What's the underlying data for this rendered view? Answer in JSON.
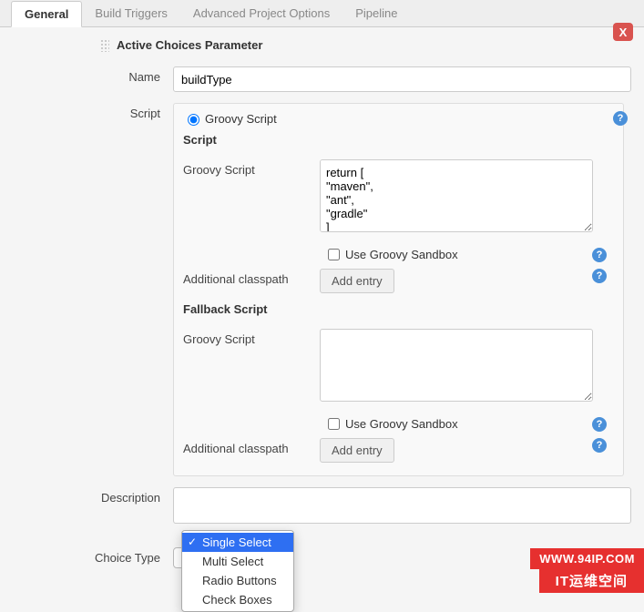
{
  "tabs": {
    "items": [
      "General",
      "Build Triggers",
      "Advanced Project Options",
      "Pipeline"
    ],
    "active_index": 0,
    "close_badge": "X"
  },
  "section": {
    "title": "Active Choices Parameter"
  },
  "labels": {
    "name": "Name",
    "script": "Script",
    "description": "Description",
    "choice_type": "Choice Type"
  },
  "fields": {
    "name_value": "buildType",
    "description_value": ""
  },
  "script_block": {
    "radio_label": "Groovy Script",
    "script_heading": "Script",
    "fallback_heading": "Fallback Script",
    "sub_labels": {
      "groovy_script": "Groovy Script",
      "additional_classpath": "Additional classpath"
    },
    "groovy_value": "return [\n\"maven\",\n\"ant\",\n\"gradle\"\n]",
    "fallback_value": "",
    "sandbox_label": "Use Groovy Sandbox",
    "sandbox_checked": false,
    "fallback_sandbox_checked": false,
    "add_entry_label": "Add entry"
  },
  "choice_type": {
    "selected": "Single Select",
    "options": [
      "Single Select",
      "Multi Select",
      "Radio Buttons",
      "Check Boxes"
    ]
  },
  "watermark": {
    "url": "WWW.94IP.COM",
    "brand": "IT运维空间"
  }
}
